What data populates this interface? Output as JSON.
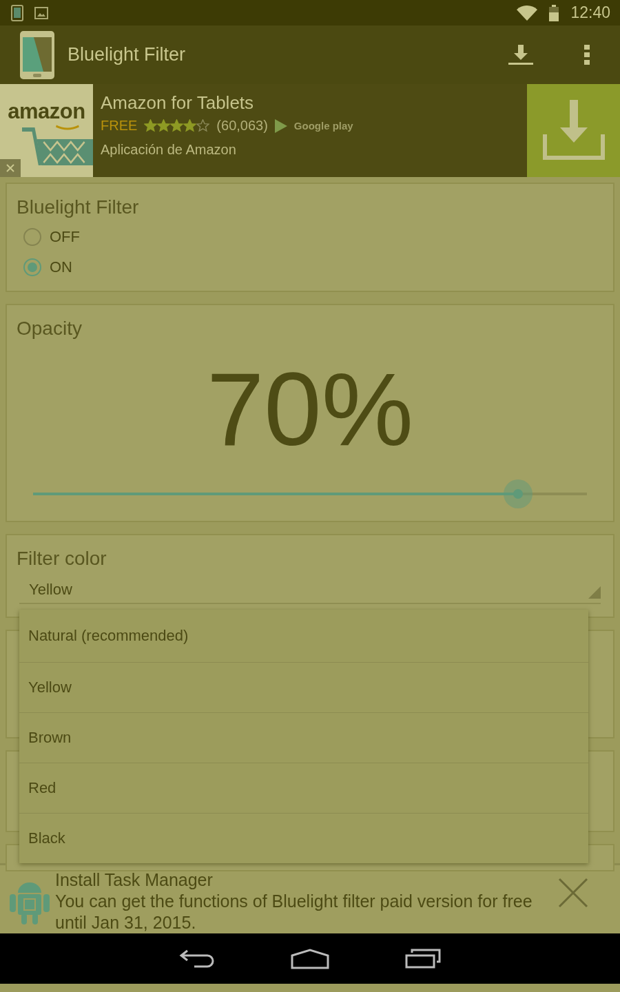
{
  "status_bar": {
    "time": "12:40"
  },
  "action_bar": {
    "title": "Bluelight Filter"
  },
  "ad": {
    "title": "Amazon for Tablets",
    "price": "FREE",
    "stars": 4,
    "reviews": "(60,063)",
    "store": "Google play",
    "subtitle": "Aplicación de Amazon",
    "logo": "amazon"
  },
  "filter_card": {
    "title": "Bluelight Filter",
    "options": [
      {
        "label": "OFF",
        "selected": false
      },
      {
        "label": "ON",
        "selected": true
      }
    ]
  },
  "opacity_card": {
    "title": "Opacity",
    "value": "70%",
    "level": 0.875
  },
  "color_card": {
    "title": "Filter color",
    "value": "Yellow"
  },
  "dropdown": {
    "items": [
      "Natural (recommended)",
      "Yellow",
      "Brown",
      "Red",
      "Black"
    ]
  },
  "notification": {
    "title": "Install Task Manager",
    "text": "You can get the functions of Bluelight filter paid version for free until Jan 31, 2015."
  }
}
